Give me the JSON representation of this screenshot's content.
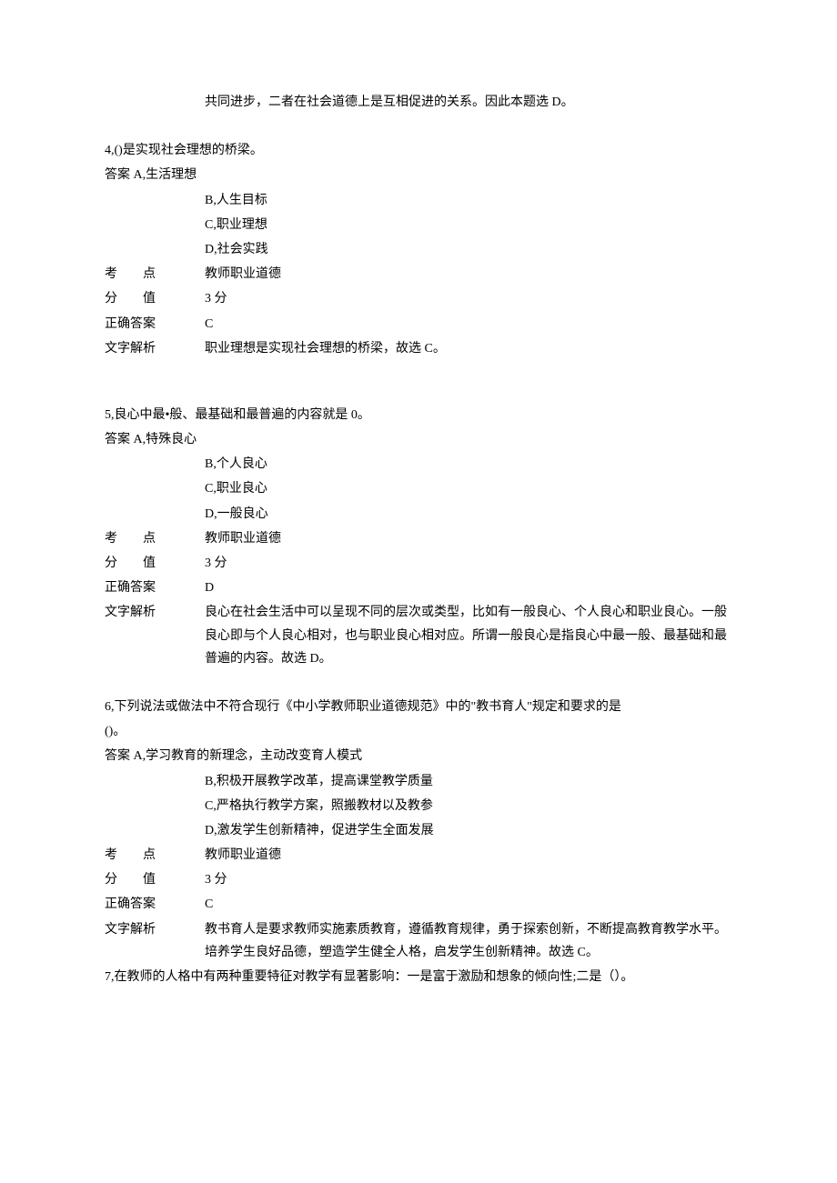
{
  "continuation_line": "共同进步，二者在社会道德上是互相促进的关系。因此本题选 D。",
  "labels": {
    "kaodian_c1": "考",
    "kaodian_c2": "点",
    "fenzhi_c1": "分",
    "fenzhi_c2": "值",
    "zhengque": "正确答案",
    "jiexi": "文字解析"
  },
  "q4": {
    "stem": "4,()是实现社会理想的桥梁。",
    "optA": "答案 A,生活理想",
    "optB": "B,人生目标",
    "optC": "C,职业理想",
    "optD": "D,社会实践",
    "kaodian": "教师职业道德",
    "fenzhi": "3 分",
    "answer": "C",
    "jiexi": "职业理想是实现社会理想的桥梁，故选 C。"
  },
  "q5": {
    "stem": "5,良心中最•般、最基础和最普遍的内容就是 0。",
    "optA": "答案 A,特殊良心",
    "optB": "B,个人良心",
    "optC": "C,职业良心",
    "optD": "D,一般良心",
    "kaodian": "教师职业道德",
    "fenzhi": "3 分",
    "answer": "D",
    "jiexi": "良心在社会生活中可以呈现不同的层次或类型，比如有一般良心、个人良心和职业良心。一般良心即与个人良心相对，也与职业良心相对应。所谓一般良心是指良心中最一般、最基础和最普遍的内容。故选 D。"
  },
  "q6": {
    "stem1": "6,下列说法或做法中不符合现行《中小学教师职业道德规范》中的\"教书育人\"规定和要求的是",
    "stem2": "()。",
    "optA": "答案 A,学习教育的新理念，主动改变育人模式",
    "optB": "B,积极开展教学改革，提高课堂教学质量",
    "optC": "C,严格执行教学方案，照搬教材以及教参",
    "optD": "D,激发学生创新精神，促进学生全面发展",
    "kaodian": "教师职业道德",
    "fenzhi": "3 分",
    "answer": "C",
    "jiexi": "教书育人是要求教师实施素质教育，遵循教育规律，勇于探索创新，不断提高教育教学水平。培养学生良好品德，塑造学生健全人格，启发学生创新精神。故选 C。"
  },
  "q7": {
    "stem": "7,在教师的人格中有两种重要特征对教学有显著影响：一是富于激励和想象的倾向性;二是（）。"
  }
}
